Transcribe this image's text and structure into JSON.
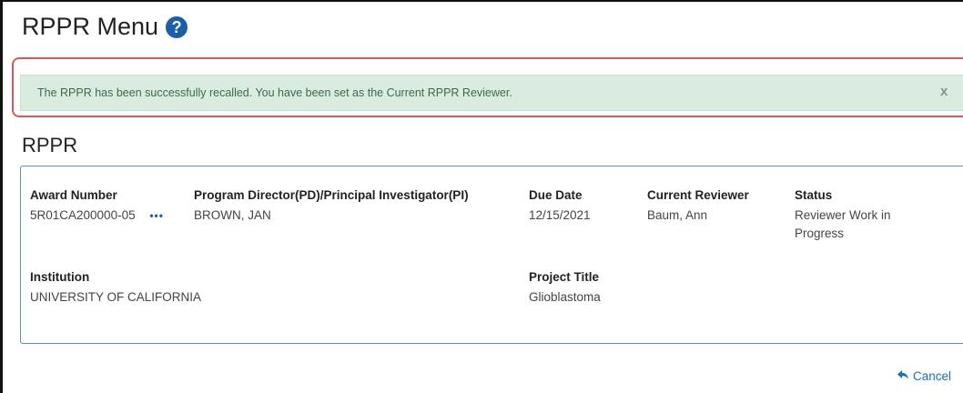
{
  "page": {
    "title": "RPPR Menu",
    "help_icon_glyph": "?"
  },
  "alert": {
    "message": "The RPPR has been successfully recalled. You have been set as the Current RPPR Reviewer.",
    "close_label": "x"
  },
  "section": {
    "title": "RPPR"
  },
  "details": {
    "award_number": {
      "label": "Award Number",
      "value": "5R01CA200000-05",
      "more_icon": "•••"
    },
    "pd_pi": {
      "label": "Program Director(PD)/Principal Investigator(PI)",
      "value": "BROWN, JAN"
    },
    "due_date": {
      "label": "Due Date",
      "value": "12/15/2021"
    },
    "current_reviewer": {
      "label": "Current Reviewer",
      "value": "Baum, Ann"
    },
    "status": {
      "label": "Status",
      "value": "Reviewer Work in Progress"
    },
    "institution": {
      "label": "Institution",
      "value": "UNIVERSITY OF CALIFORNIA"
    },
    "project_title": {
      "label": "Project Title",
      "value": "Glioblastoma"
    }
  },
  "actions": {
    "cancel_label": "Cancel",
    "cancel_icon": "reply-arrow-icon"
  },
  "colors": {
    "accent": "#1a5fa8",
    "alert_bg": "#d9ecdf",
    "alert_text": "#3c6b4a",
    "highlight_outline": "#e05555",
    "panel_border": "#5b8ec5"
  }
}
